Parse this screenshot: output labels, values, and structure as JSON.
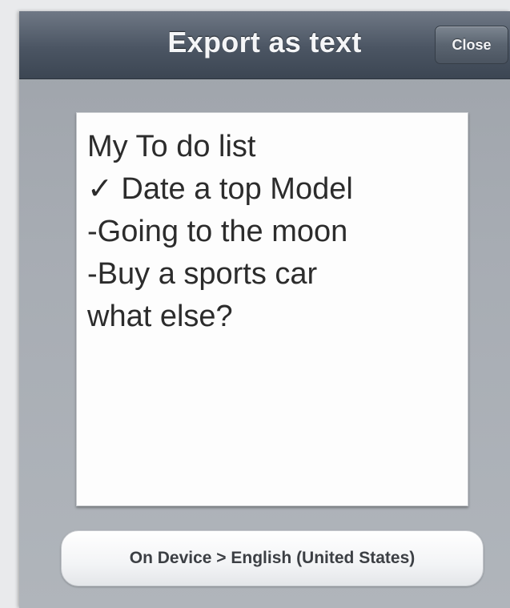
{
  "dialog": {
    "title": "Export as text",
    "close_label": "Close"
  },
  "note": {
    "lines": [
      "My To do list",
      "✓ Date a top Model",
      "-Going to the moon",
      "-Buy a sports car",
      "what else?"
    ]
  },
  "language_selector": {
    "label": "On Device > English (United States)"
  }
}
